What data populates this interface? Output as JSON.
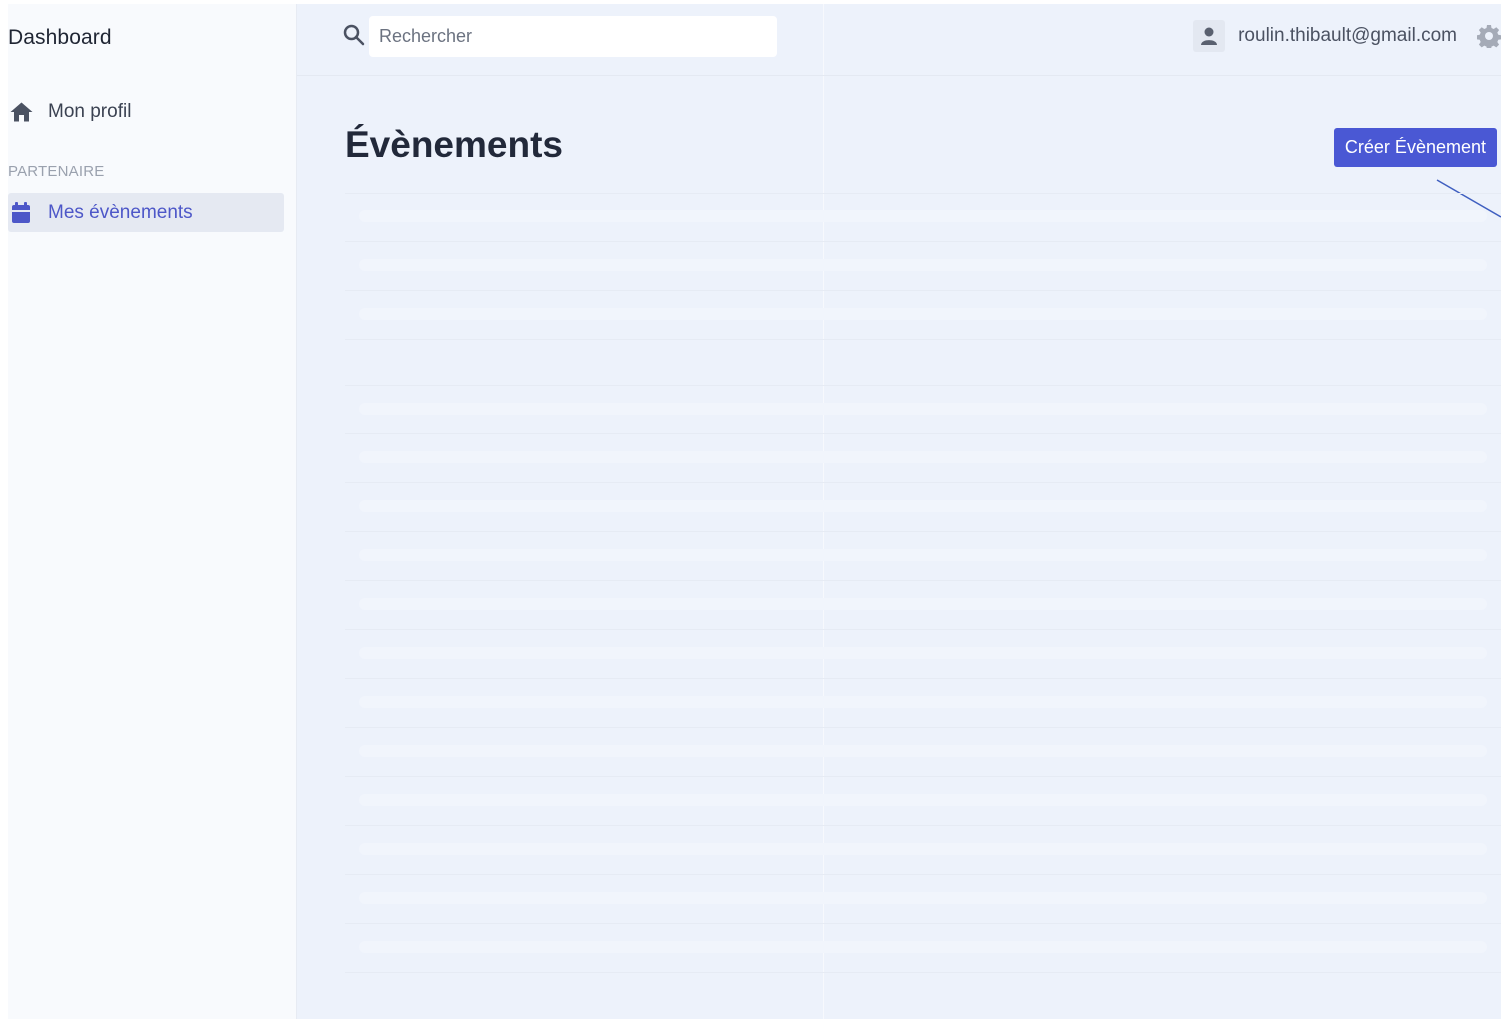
{
  "sidebar": {
    "brand": "Dashboard",
    "items": [
      {
        "label": "Mon profil",
        "icon": "home-icon"
      },
      {
        "label": "Mes évènements",
        "icon": "calendar-icon",
        "active": true
      }
    ],
    "section_title": "PARTENAIRE"
  },
  "header": {
    "search": {
      "placeholder": "Rechercher",
      "value": ""
    },
    "user_email": "roulin.thibault@gmail.com",
    "icons": [
      "search-icon",
      "user-icon",
      "settings-icon"
    ]
  },
  "main": {
    "title": "Évènements",
    "create_button_label": "Créer Évènement",
    "table_state": "loading"
  },
  "colors": {
    "accent": "#4a58d4",
    "sidebar_background": "#f8fafd",
    "main_background": "#edf2fb",
    "active_item_background": "#e5e9f2",
    "annotation_line": "#3f5fc0"
  }
}
